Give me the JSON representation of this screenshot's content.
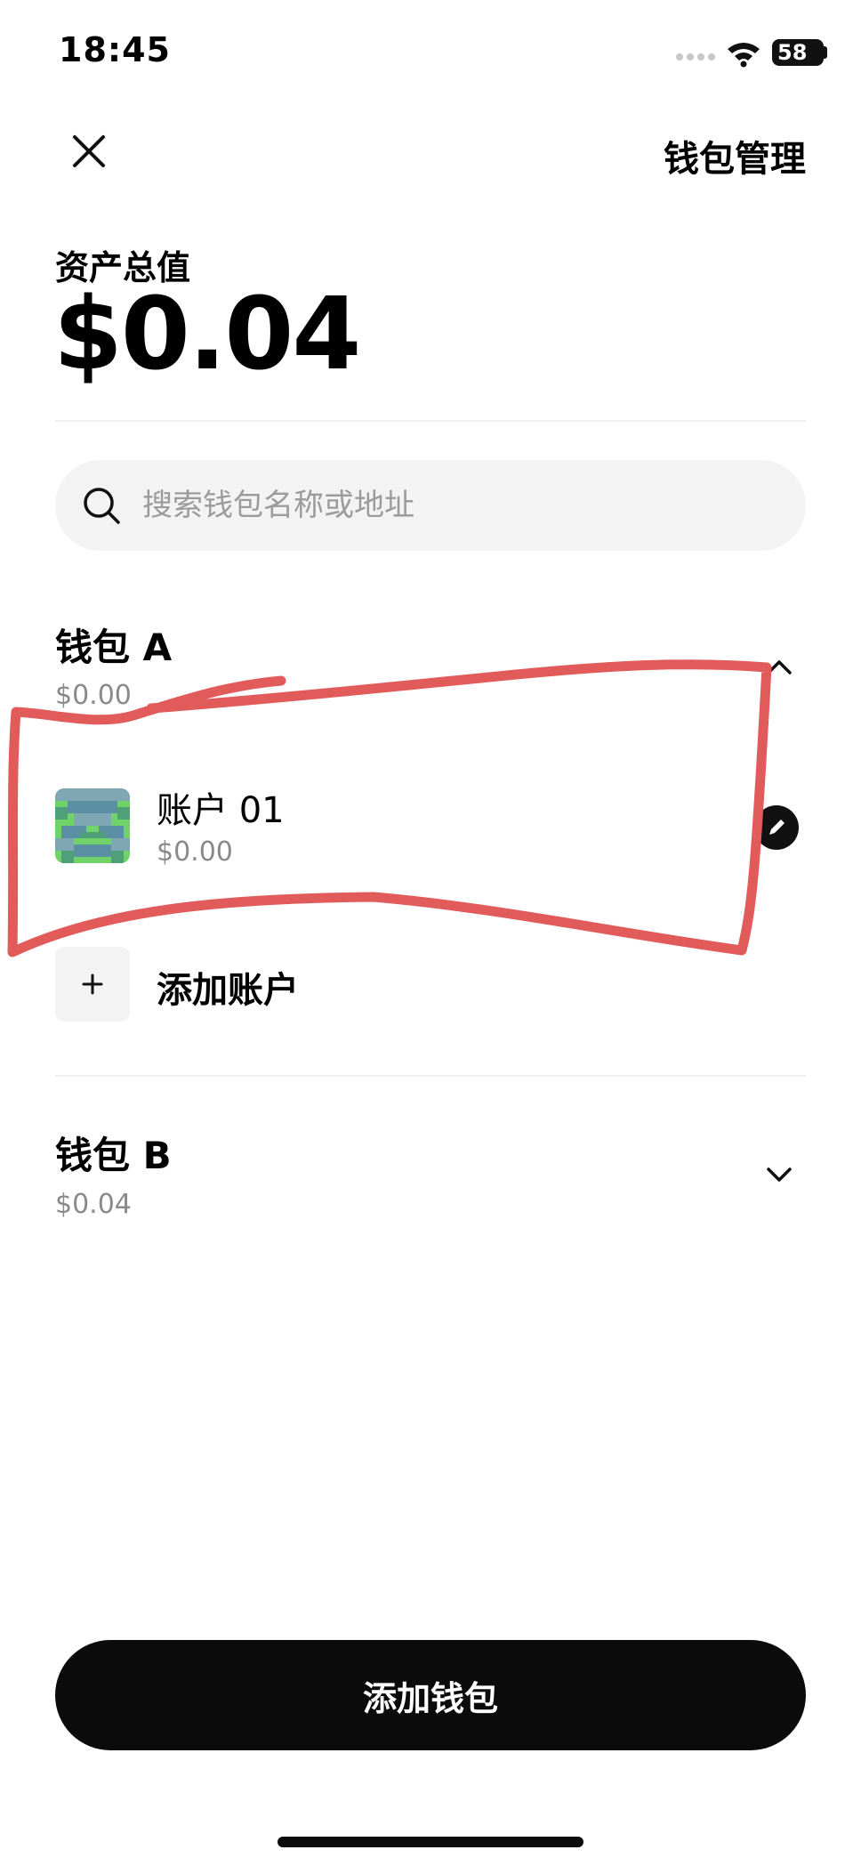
{
  "status_bar": {
    "time": "18:45",
    "battery": "58"
  },
  "header": {
    "close_icon": "close-icon",
    "title": "钱包管理"
  },
  "assets": {
    "label": "资产总值",
    "value": "$0.04"
  },
  "search": {
    "placeholder": "搜索钱包名称或地址",
    "value": ""
  },
  "wallets": [
    {
      "name": "钱包 A",
      "value": "$0.00",
      "expanded": true,
      "accounts": [
        {
          "name": "账户 01",
          "value": "$0.00"
        }
      ],
      "add_account_label": "添加账户"
    },
    {
      "name": "钱包 B",
      "value": "$0.04",
      "expanded": false
    }
  ],
  "footer": {
    "add_wallet_label": "添加钱包"
  },
  "colors": {
    "annotation": "#e15b5b",
    "button_bg": "#0b0b0b",
    "muted_text": "#8a8a8a",
    "search_bg": "#f3f3f3"
  }
}
